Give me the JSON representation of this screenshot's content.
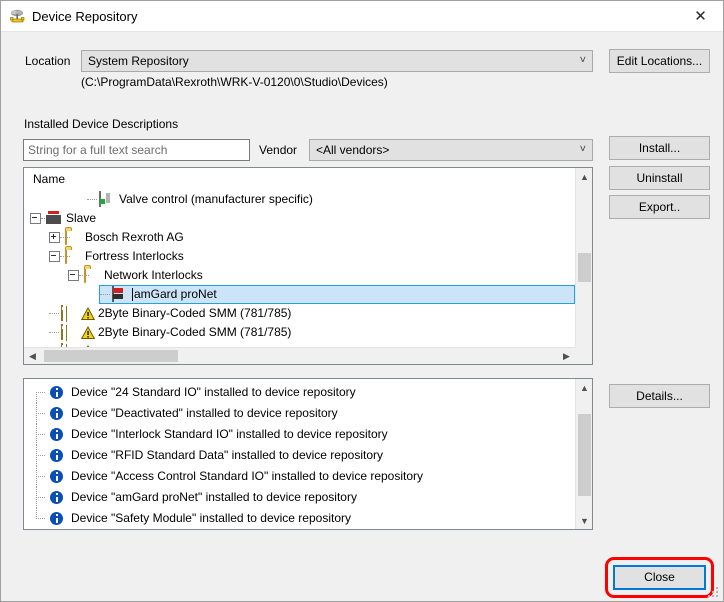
{
  "window": {
    "title": "Device Repository",
    "icon": "device-repository-icon",
    "close_icon": "close-icon"
  },
  "location": {
    "label": "Location",
    "selected": "System Repository",
    "path": "(C:\\ProgramData\\Rexroth\\WRK-V-0120\\0\\Studio\\Devices)",
    "edit_button": "Edit Locations..."
  },
  "installed": {
    "group_label": "Installed Device Descriptions",
    "search_placeholder": "String for a full text search",
    "search_value": "",
    "vendor_label": "Vendor",
    "vendor_selected": "<All vendors>"
  },
  "buttons": {
    "install": "Install...",
    "uninstall": "Uninstall",
    "export": "Export..",
    "details": "Details...",
    "close": "Close"
  },
  "tree": {
    "header": "Name",
    "rows": [
      {
        "label": "Valve control (manufacturer specific)",
        "indent": 4,
        "icon": "valve-device-icon",
        "expander": "none",
        "warning": false,
        "selected": false
      },
      {
        "label": "Slave",
        "indent": 1,
        "icon": "slave-device-icon",
        "expander": "minus",
        "warning": false,
        "selected": false
      },
      {
        "label": "Bosch Rexroth AG",
        "indent": 2,
        "icon": "folder-icon",
        "expander": "plus",
        "warning": false,
        "selected": false
      },
      {
        "label": "Fortress Interlocks",
        "indent": 2,
        "icon": "folder-icon",
        "expander": "minus",
        "warning": false,
        "selected": false
      },
      {
        "label": "Network Interlocks",
        "indent": 3,
        "icon": "folder-icon",
        "expander": "minus",
        "warning": false,
        "selected": false
      },
      {
        "label": "amGard proNet",
        "indent": 4,
        "icon": "network-device-icon",
        "expander": "none",
        "warning": false,
        "selected": true
      },
      {
        "label": "2Byte Binary-Coded SMM (781/785)",
        "indent": 2,
        "icon": "module-icon",
        "expander": "none",
        "warning": true,
        "selected": false
      },
      {
        "label": "2Byte Binary-Coded SMM (781/785)",
        "indent": 2,
        "icon": "module-icon",
        "expander": "none",
        "warning": true,
        "selected": false
      },
      {
        "label": "",
        "indent": 2,
        "icon": "module-icon",
        "expander": "none",
        "warning": true,
        "selected": false
      }
    ],
    "scroll_up_icon": "chevron-up-icon",
    "scroll_down_icon": "chevron-down-icon",
    "scroll_left_icon": "chevron-left-icon",
    "scroll_right_icon": "chevron-right-icon"
  },
  "log": {
    "entries": [
      {
        "icon": "info-icon",
        "text": "Device \"24 Standard IO\" installed to device repository"
      },
      {
        "icon": "info-icon",
        "text": "Device \"Deactivated\" installed to device repository"
      },
      {
        "icon": "info-icon",
        "text": "Device \"Interlock Standard IO\" installed to device repository"
      },
      {
        "icon": "info-icon",
        "text": "Device \"RFID Standard Data\" installed to device repository"
      },
      {
        "icon": "info-icon",
        "text": "Device \"Access Control Standard IO\" installed to device repository"
      },
      {
        "icon": "info-icon",
        "text": "Device \"amGard proNet\" installed to device repository"
      },
      {
        "icon": "info-icon",
        "text": "Device \"Safety Module\" installed to device repository"
      }
    ]
  },
  "annotation": {
    "highlight_color": "#ff0000",
    "focus_color": "#0078d7"
  }
}
